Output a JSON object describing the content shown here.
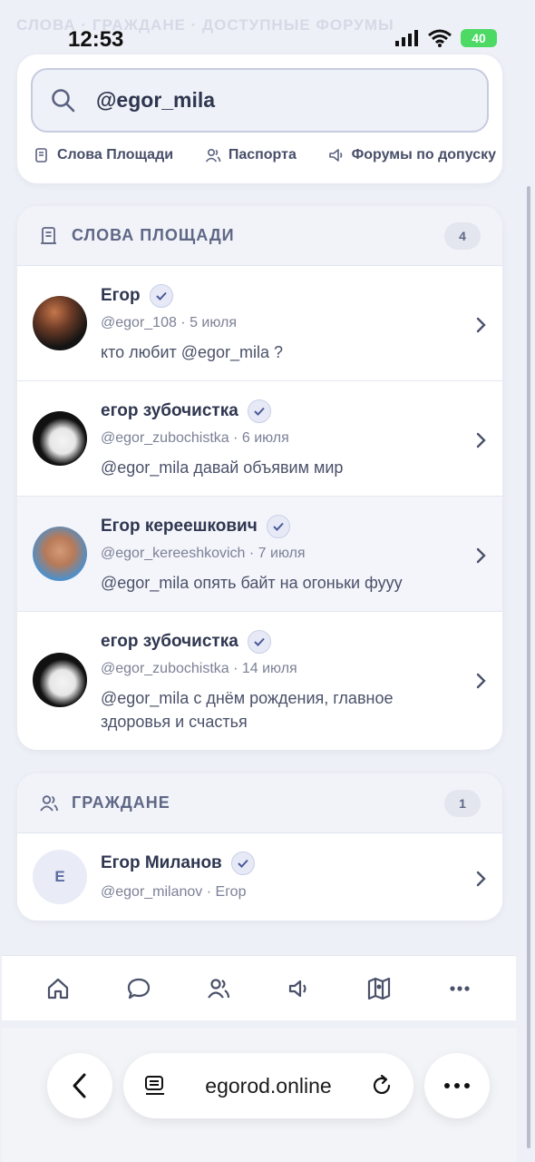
{
  "status": {
    "time": "12:53",
    "battery": "40"
  },
  "background_tabs": "СЛОВА · ГРАЖДАНЕ · ДОСТУПНЫЕ ФОРУМЫ",
  "search": {
    "query": "@egor_mila",
    "filters": [
      {
        "label": "Слова Площади",
        "icon": "scroll-icon"
      },
      {
        "label": "Паспорта",
        "icon": "users-icon"
      },
      {
        "label": "Форумы по допуску",
        "icon": "speaker-icon"
      }
    ]
  },
  "words_section": {
    "title": "СЛОВА ПЛОЩАДИ",
    "count": "4",
    "items": [
      {
        "name": "Егор",
        "handle": "@egor_108",
        "date": "5 июля",
        "text": "кто любит @egor_mila ?"
      },
      {
        "name": "егор зубочистка",
        "handle": "@egor_zubochistka",
        "date": "6 июля",
        "text": "@egor_mila давай объявим мир"
      },
      {
        "name": "Егор кереешкович",
        "handle": "@egor_kereeshkovich",
        "date": "7 июля",
        "text": "@egor_mila опять байт на огоньки фууу"
      },
      {
        "name": "егор зубочистка",
        "handle": "@egor_zubochistka",
        "date": "14 июля",
        "text": "@egor_mila с днём рождения, главное здоровья и счастья"
      }
    ]
  },
  "citizens_section": {
    "title": "ГРАЖДАНЕ",
    "count": "1",
    "items": [
      {
        "initial": "E",
        "name": "Егор Миланов",
        "handle": "@egor_milanov",
        "sub": "Егор"
      }
    ]
  },
  "bottom_nav": [
    "home-icon",
    "chat-icon",
    "users-icon",
    "speaker-icon",
    "map-icon",
    "more-icon"
  ],
  "browser": {
    "url": "egorod.online"
  },
  "colors": {
    "accent": "#2f3650",
    "muted": "#7b8197",
    "verified": "#4a5a9a"
  }
}
